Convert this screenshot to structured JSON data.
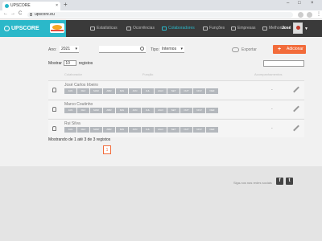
{
  "browser": {
    "tab_title": "UPSCORE",
    "tab_close": "×",
    "new_tab": "+",
    "url": "upscore.eu",
    "nav": {
      "back": "←",
      "forward": "→",
      "reload": "C"
    },
    "window": {
      "minimize": "–",
      "maximize": "□",
      "close": "×"
    }
  },
  "app": {
    "logo_text": "UPSCORE",
    "nav": [
      {
        "label": "Estatísticas",
        "icon": "chart-icon"
      },
      {
        "label": "Ocorrências",
        "icon": "alert-icon"
      },
      {
        "label": "Colaboradores",
        "icon": "people-icon",
        "active": true
      },
      {
        "label": "Funções",
        "icon": "puzzle-icon"
      },
      {
        "label": "Empresas",
        "icon": "building-icon"
      },
      {
        "label": "Melhoria",
        "icon": "refresh-icon"
      }
    ],
    "user_name": "José",
    "accent": "#2bb8c9",
    "nav_bg": "#3a3a3a",
    "add_color": "#f26b3a"
  },
  "filters": {
    "ano_label": "Ano:",
    "ano_value": "2021",
    "tipo_label": "Tipo:",
    "tipo_value": "Internos",
    "search_value": ""
  },
  "actions": {
    "export": "Exportar",
    "add": "Adicionar",
    "add_plus": "+"
  },
  "table": {
    "mostrar": "Mostrar",
    "page_size": "10",
    "registos": "registos",
    "columns": [
      "Colaborador",
      "Função",
      "Acompanhamentos"
    ],
    "months": [
      "JAN",
      "FEV",
      "MAR",
      "ABR",
      "MAI",
      "JUN",
      "JUL",
      "AGO",
      "SET",
      "OUT",
      "NOV",
      "DEZ"
    ],
    "rows": [
      {
        "name": "José Carlos Irbeiro",
        "value": "-"
      },
      {
        "name": "Marco Coutinho",
        "value": "-"
      },
      {
        "name": "Rui Silva",
        "value": "-"
      }
    ],
    "info": "Mostrando de 1 até 3 de 3 registos",
    "current_page": "1"
  },
  "footer": {
    "social_text": "Siga-nos nas redes sociais",
    "fb": "f",
    "tw": "t"
  }
}
